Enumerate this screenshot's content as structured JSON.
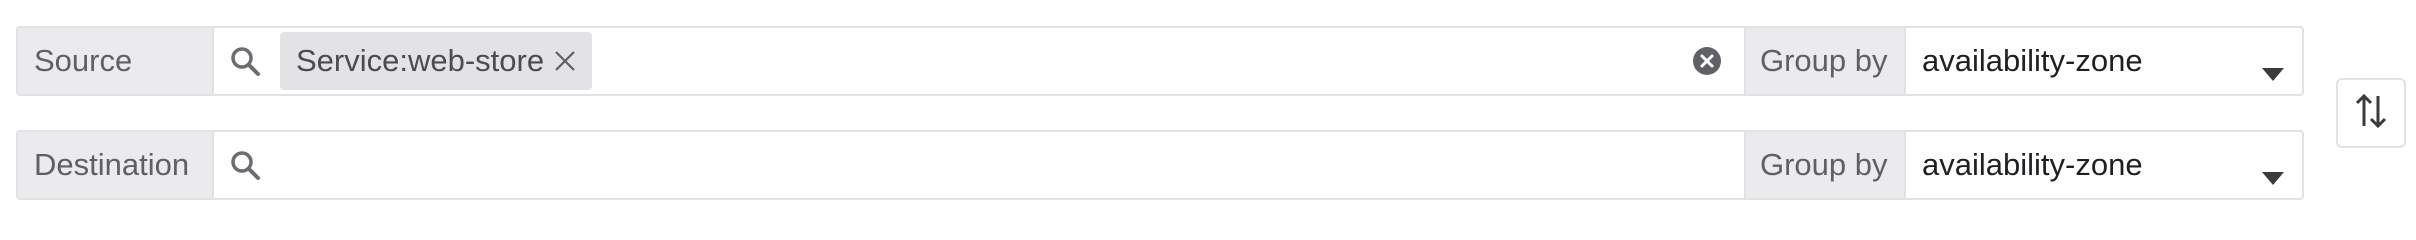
{
  "source": {
    "label": "Source",
    "filter_chip": "Service:web-store",
    "group_by_label": "Group by",
    "group_by_value": "availability-zone"
  },
  "destination": {
    "label": "Destination",
    "group_by_label": "Group by",
    "group_by_value": "availability-zone"
  },
  "icons": {
    "search": "search-icon",
    "chip_remove": "close-icon",
    "clear": "clear-circle-icon",
    "caret": "caret-down-icon",
    "swap": "swap-vertical-icon"
  }
}
